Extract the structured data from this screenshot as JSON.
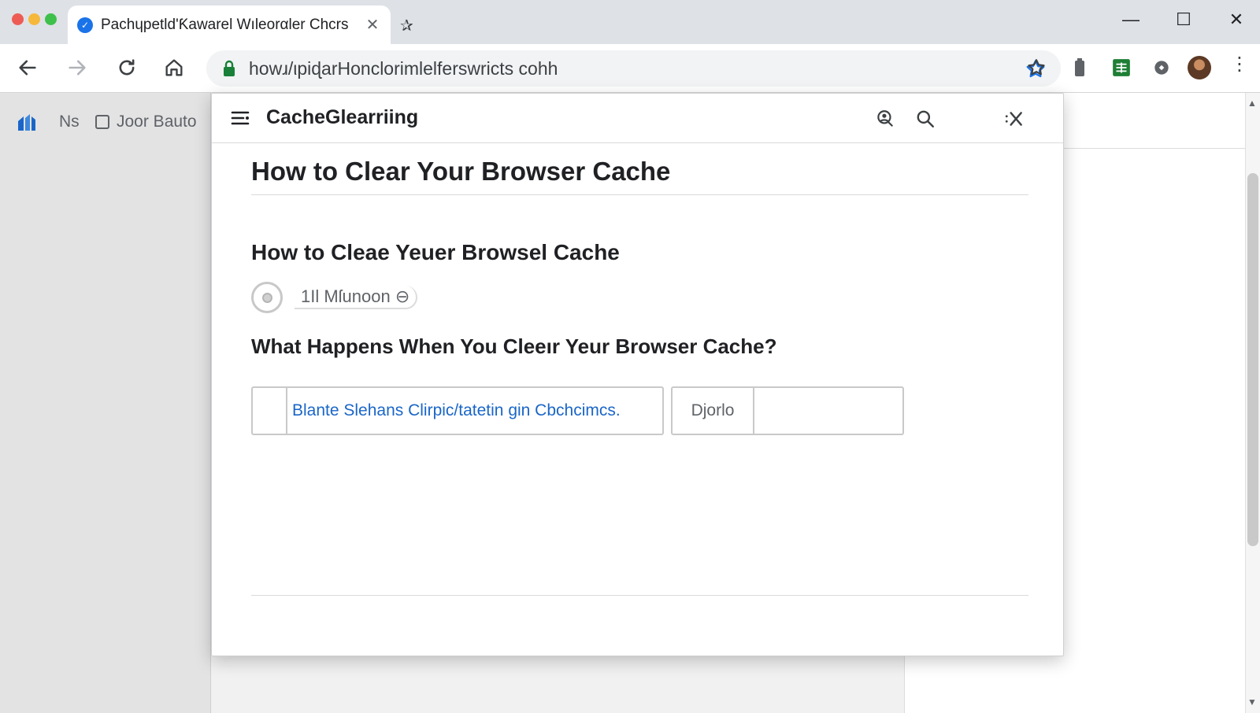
{
  "browser": {
    "tab": {
      "title": "Pachɥpetld'Ƙawarel Wıleorαler Chcrs",
      "favicon": "check-circle-icon",
      "close": "✕"
    },
    "new_tab_glyph": "✰",
    "window_controls": {
      "minimize": "—",
      "maximize": "☐",
      "close": "✕"
    },
    "url": "howɹ/ιpiɖarHonclorimlelferswricts cohh",
    "bookmarks": {
      "ns_label": "Ns",
      "folder_label": "Joor Bauto"
    },
    "colors": {
      "accent": "#1a73e8",
      "lock": "#188038",
      "ext_green": "#1e7e34"
    }
  },
  "overlay": {
    "title": "CacheGlearriing",
    "h1": "How to Clear Your Browser Cache",
    "h2": "How to Cleae Yeuer Browsel Cache",
    "meta": "1Il Mſunoon ⊖",
    "h3": "What Happens When You Cleeır Yeur Browser Cache?",
    "link_text": "Blante Slehans Clirpic/tatetin gin Cbchcimcs.",
    "side_label": "Djorlo"
  }
}
